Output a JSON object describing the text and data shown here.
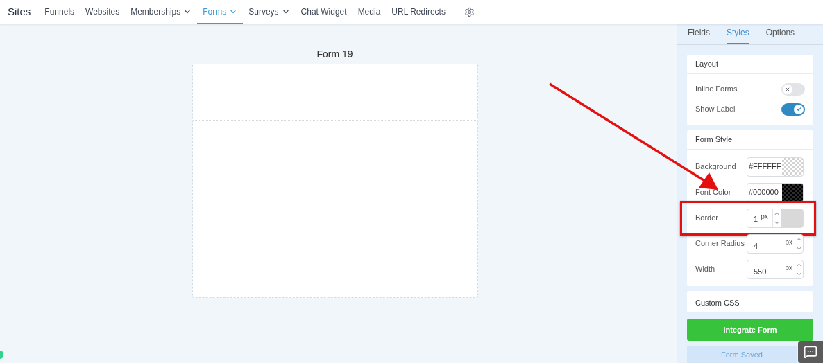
{
  "nav": {
    "brand": "Sites",
    "items": [
      {
        "label": "Funnels",
        "dropdown": false,
        "selected": false
      },
      {
        "label": "Websites",
        "dropdown": false,
        "selected": false
      },
      {
        "label": "Memberships",
        "dropdown": true,
        "selected": false
      },
      {
        "label": "Forms",
        "dropdown": true,
        "selected": true
      },
      {
        "label": "Surveys",
        "dropdown": true,
        "selected": false
      },
      {
        "label": "Chat Widget",
        "dropdown": false,
        "selected": false
      },
      {
        "label": "Media",
        "dropdown": false,
        "selected": false
      },
      {
        "label": "URL Redirects",
        "dropdown": false,
        "selected": false
      }
    ]
  },
  "canvas": {
    "form_title": "Form 19"
  },
  "panel": {
    "tabs": [
      {
        "label": "Fields",
        "selected": false
      },
      {
        "label": "Styles",
        "selected": true
      },
      {
        "label": "Options",
        "selected": false
      }
    ],
    "layout": {
      "title": "Layout",
      "toggles": [
        {
          "label": "Inline Forms",
          "on": false
        },
        {
          "label": "Show Label",
          "on": true
        }
      ]
    },
    "form_style": {
      "title": "Form Style",
      "rows": [
        {
          "kind": "color",
          "label": "Background",
          "value": "#FFFFFF"
        },
        {
          "kind": "color",
          "label": "Font Color",
          "value": "#000000"
        },
        {
          "kind": "border",
          "label": "Border",
          "value": "1",
          "unit": "px",
          "highlighted": true
        },
        {
          "kind": "number",
          "label": "Corner Radius",
          "value": "4",
          "unit": "px",
          "highlighted": false
        },
        {
          "kind": "number",
          "label": "Width",
          "value": "550",
          "unit": "px",
          "highlighted": false
        }
      ]
    },
    "custom_css": {
      "title": "Custom CSS"
    },
    "buttons": {
      "primary": "Integrate Form",
      "secondary": "Form Saved"
    }
  }
}
